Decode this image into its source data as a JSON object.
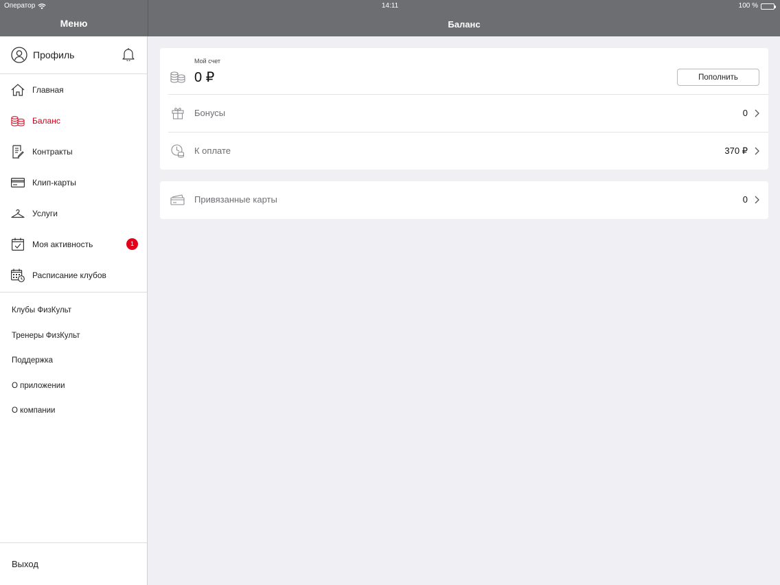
{
  "status_bar": {
    "carrier": "Оператор",
    "time": "14:11",
    "battery": "100 %"
  },
  "sidebar": {
    "title": "Меню",
    "profile_label": "Профиль",
    "nav": [
      {
        "label": "Главная",
        "icon": "home-icon"
      },
      {
        "label": "Баланс",
        "icon": "coins-icon",
        "active": true
      },
      {
        "label": "Контракты",
        "icon": "contract-icon"
      },
      {
        "label": "Клип-карты",
        "icon": "card-icon"
      },
      {
        "label": "Услуги",
        "icon": "hanger-icon"
      },
      {
        "label": "Моя активность",
        "icon": "calendar-check-icon",
        "badge": "1"
      },
      {
        "label": "Расписание клубов",
        "icon": "schedule-icon"
      }
    ],
    "links": [
      "Клубы ФизКульт",
      "Тренеры ФизКульт",
      "Поддержка",
      "О приложении",
      "О компании"
    ],
    "logout_label": "Выход"
  },
  "main": {
    "title": "Баланс",
    "account": {
      "label": "Мой счет",
      "value": "0 ₽",
      "topup_label": "Пополнить"
    },
    "bonuses": {
      "label": "Бонусы",
      "value": "0"
    },
    "to_pay": {
      "label": "К оплате",
      "value": "370 ₽"
    },
    "linked_cards": {
      "label": "Привязанные карты",
      "value": "0"
    }
  },
  "colors": {
    "header": "#6d6e71",
    "accent": "#d0021b",
    "background": "#efeff4"
  }
}
